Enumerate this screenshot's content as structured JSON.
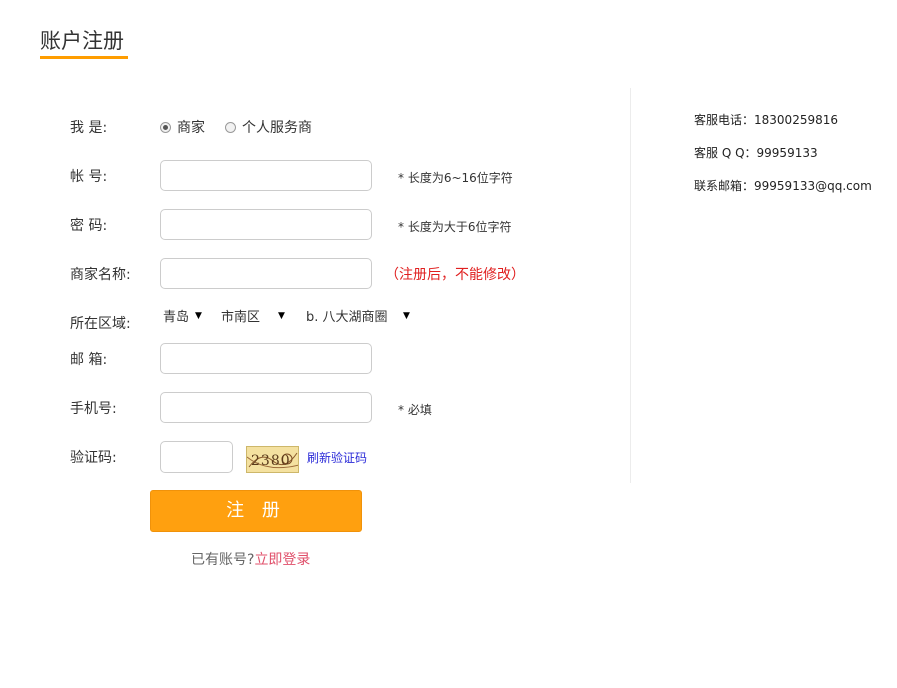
{
  "page": {
    "title": "账户注册"
  },
  "form": {
    "role": {
      "label": "我 是:",
      "options": [
        {
          "label": "商家",
          "checked": true
        },
        {
          "label": "个人服务商",
          "checked": false
        }
      ]
    },
    "account": {
      "label": "帐 号:",
      "value": "",
      "hint": "* 长度为6~16位字符"
    },
    "password": {
      "label": "密 码:",
      "value": "",
      "hint": "* 长度为大于6位字符"
    },
    "merchant_name": {
      "label": "商家名称:",
      "value": "",
      "hint": "（注册后，不能修改）"
    },
    "region": {
      "label": "所在区域:",
      "city": "青岛",
      "district": "市南区",
      "zone": "b. 八大湖商圈"
    },
    "email": {
      "label": "邮 箱:",
      "value": ""
    },
    "phone": {
      "label": "手机号:",
      "value": "",
      "hint": "* 必填"
    },
    "captcha": {
      "label": "验证码:",
      "value": "",
      "image_text": "2380",
      "refresh_label": "刷新验证码"
    },
    "submit_label": "注 册",
    "login_prompt": "已有账号?",
    "login_link": "立即登录"
  },
  "contact": {
    "phone": {
      "label": "客服电话：",
      "value": "18300259816"
    },
    "qq": {
      "label": "客服 Q Q：",
      "value": "99959133"
    },
    "email": {
      "label": "联系邮箱：",
      "value": "99959133@qq.com"
    }
  },
  "colors": {
    "accent": "#ffa00f",
    "hint_red": "#e02020",
    "link_blue": "#2b2bd8",
    "login_link": "#e04f6a"
  }
}
